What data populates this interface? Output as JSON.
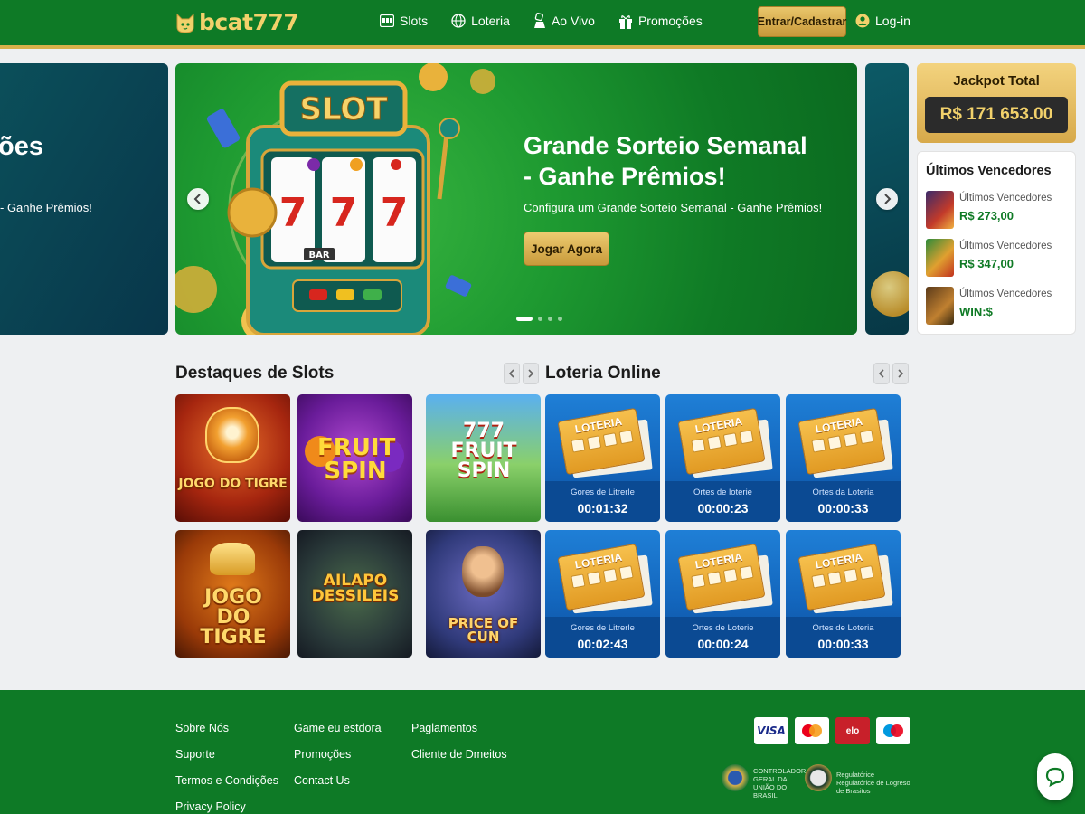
{
  "header": {
    "logo_text": "bcat777",
    "nav": [
      {
        "label": "Slots",
        "icon": "slot-machine-icon"
      },
      {
        "label": "Loteria",
        "icon": "globe-icon"
      },
      {
        "label": "Ao Vivo",
        "icon": "dice-hand-icon"
      },
      {
        "label": "Promoções",
        "icon": "gift-icon"
      }
    ],
    "register_label": "Entrar/Cadastrar",
    "login_label": "Log-in"
  },
  "hero": {
    "prev_slide_title": "ões",
    "prev_slide_sub": "- Ganhe Prêmios!",
    "slot_sign": "SLOT",
    "title": "Grande Sorteio Semanal - Ganhe Prêmios!",
    "subtitle": "Configura um Grande Sorteio Semanal - Ganhe Prêmios!",
    "cta_label": "Jogar Agora",
    "active_slide": 1,
    "slide_count": 4
  },
  "jackpot": {
    "label": "Jackpot Total",
    "value": "R$ 171 653.00"
  },
  "winners": {
    "title": "Últimos Vencedores",
    "items": [
      {
        "label": "Últimos Vencedores",
        "amount": "R$ 273,00"
      },
      {
        "label": "Últimos Vencedores",
        "amount": "R$ 347,00"
      },
      {
        "label": "Últimos Vencedores",
        "amount": "WIN:$"
      }
    ]
  },
  "slots": {
    "title": "Destaques de Slots",
    "games": [
      {
        "name": "JOGO DO TIGRE"
      },
      {
        "name": "FRUIT SPIN"
      },
      {
        "name": "777 FRUIT SPIN"
      },
      {
        "name": "JOGO DO TIGRE"
      },
      {
        "name": "AILAPO DESSILEIS"
      },
      {
        "name": "PRICE OF CUN"
      }
    ]
  },
  "lottery": {
    "title": "Loteria Online",
    "ticket_word": "LOTERIA",
    "items": [
      {
        "caption": "Gores de Litrerle",
        "timer": "00:01:32"
      },
      {
        "caption": "Ortes de loterie",
        "timer": "00:00:23"
      },
      {
        "caption": "Ortes da Loteria",
        "timer": "00:00:33"
      },
      {
        "caption": "Gores de Litrerle",
        "timer": "00:02:43"
      },
      {
        "caption": "Ortes de Loterie",
        "timer": "00:00:24"
      },
      {
        "caption": "Ortes de Loteria",
        "timer": "00:00:33"
      }
    ]
  },
  "footer": {
    "col1": [
      "Sobre Nós",
      "Suporte",
      "Termos e Condições",
      "Privacy Policy"
    ],
    "col2": [
      "Game eu estdora",
      "Promoções",
      "Contact Us"
    ],
    "col3": [
      "Paglamentos",
      "Cliente de Dmeitos"
    ],
    "payments": [
      "VISA",
      "mastercard",
      "elo",
      "maestro"
    ],
    "reg1": "CONTROLADORIA GERAL DA UNIÃO DO BRASIL",
    "reg2": "Regulatórice Regulatóricé de Logreso de Brasitos"
  },
  "colors": {
    "brand_green": "#0e7a26",
    "gold": "#d8b04a",
    "win_green": "#0f7a25",
    "lottery_blue": "#1366bd"
  }
}
